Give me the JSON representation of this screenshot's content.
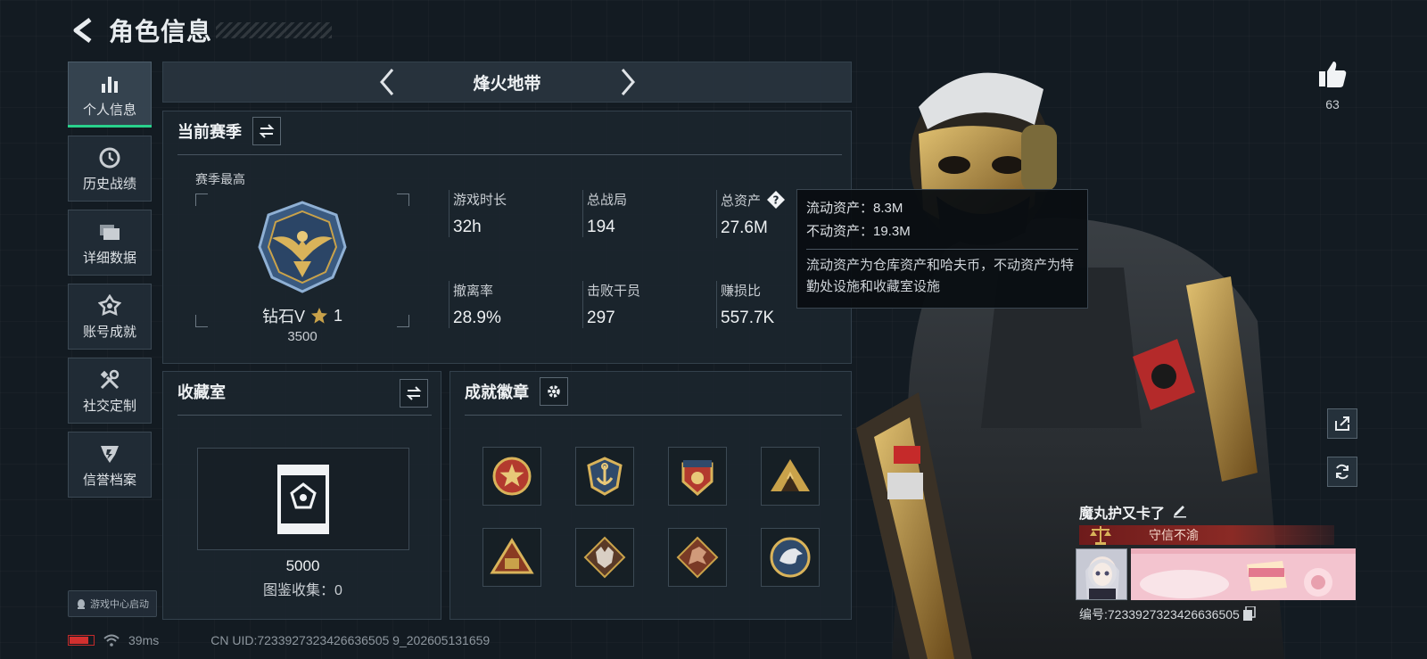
{
  "header": {
    "title": "角色信息"
  },
  "sidenav": {
    "items": [
      {
        "label": "个人信息",
        "icon": "bar-chart-icon",
        "active": true
      },
      {
        "label": "历史战绩",
        "icon": "clock-icon",
        "active": false
      },
      {
        "label": "详细数据",
        "icon": "folder-icon",
        "active": false
      },
      {
        "label": "账号成就",
        "icon": "achievement-icon",
        "active": false
      },
      {
        "label": "社交定制",
        "icon": "tools-icon",
        "active": false
      },
      {
        "label": "信誉档案",
        "icon": "shield-icon",
        "active": false
      }
    ],
    "launch_label": "游戏中心启动"
  },
  "mode": {
    "name": "烽火地带"
  },
  "season": {
    "title": "当前赛季",
    "high_label": "赛季最高",
    "rank": "钻石V",
    "stars": "1",
    "points": "3500",
    "stats": [
      {
        "label": "游戏时长",
        "value": "32h"
      },
      {
        "label": "总战局",
        "value": "194"
      },
      {
        "label": "总资产",
        "value": "27.6M"
      },
      {
        "label": "撤离率",
        "value": "28.9%"
      },
      {
        "label": "击败干员",
        "value": "297"
      },
      {
        "label": "赚损比",
        "value": "557.7K"
      }
    ]
  },
  "tooltip": {
    "liquid": "流动资产：8.3M",
    "fixed": "不动资产：19.3M",
    "description": "流动资产为仓库资产和哈夫币，不动资产为特勤处设施和收藏室设施"
  },
  "collection": {
    "title": "收藏室",
    "value": "5000",
    "count": "图鉴收集：0"
  },
  "achievement": {
    "title": "成就徽章",
    "badges": [
      "star-badge-icon",
      "anchor-badge-icon",
      "eagle-badge-icon",
      "mountain-badge-icon",
      "pyramid-badge-icon",
      "wolf-badge-icon",
      "dragon-badge-icon",
      "eagle-head-badge-icon"
    ]
  },
  "social": {
    "likes": "63",
    "player_name": "魔丸护又卡了",
    "honor": "守信不渝",
    "player_id": "编号:7233927323426636505"
  },
  "status": {
    "ping": "39ms",
    "uid": "CN UID:7233927323426636505 9_202605131659",
    "battery_level": 0.8
  },
  "colors": {
    "accent": "#29d18c",
    "honor": "#8a2a25",
    "gold": "#c9a24a"
  }
}
